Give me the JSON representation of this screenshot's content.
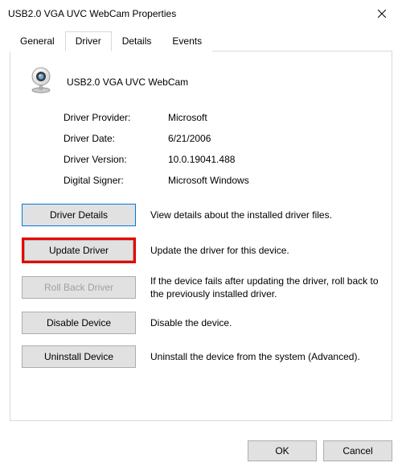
{
  "window": {
    "title": "USB2.0 VGA UVC WebCam Properties"
  },
  "tabs": {
    "general": "General",
    "driver": "Driver",
    "details": "Details",
    "events": "Events"
  },
  "device": {
    "name": "USB2.0 VGA UVC WebCam"
  },
  "info": {
    "provider_label": "Driver Provider:",
    "provider_value": "Microsoft",
    "date_label": "Driver Date:",
    "date_value": "6/21/2006",
    "version_label": "Driver Version:",
    "version_value": "10.0.19041.488",
    "signer_label": "Digital Signer:",
    "signer_value": "Microsoft Windows"
  },
  "actions": {
    "details_btn": "Driver Details",
    "details_desc": "View details about the installed driver files.",
    "update_btn": "Update Driver",
    "update_desc": "Update the driver for this device.",
    "rollback_btn": "Roll Back Driver",
    "rollback_desc": "If the device fails after updating the driver, roll back to the previously installed driver.",
    "disable_btn": "Disable Device",
    "disable_desc": "Disable the device.",
    "uninstall_btn": "Uninstall Device",
    "uninstall_desc": "Uninstall the device from the system (Advanced)."
  },
  "dialog": {
    "ok": "OK",
    "cancel": "Cancel"
  }
}
